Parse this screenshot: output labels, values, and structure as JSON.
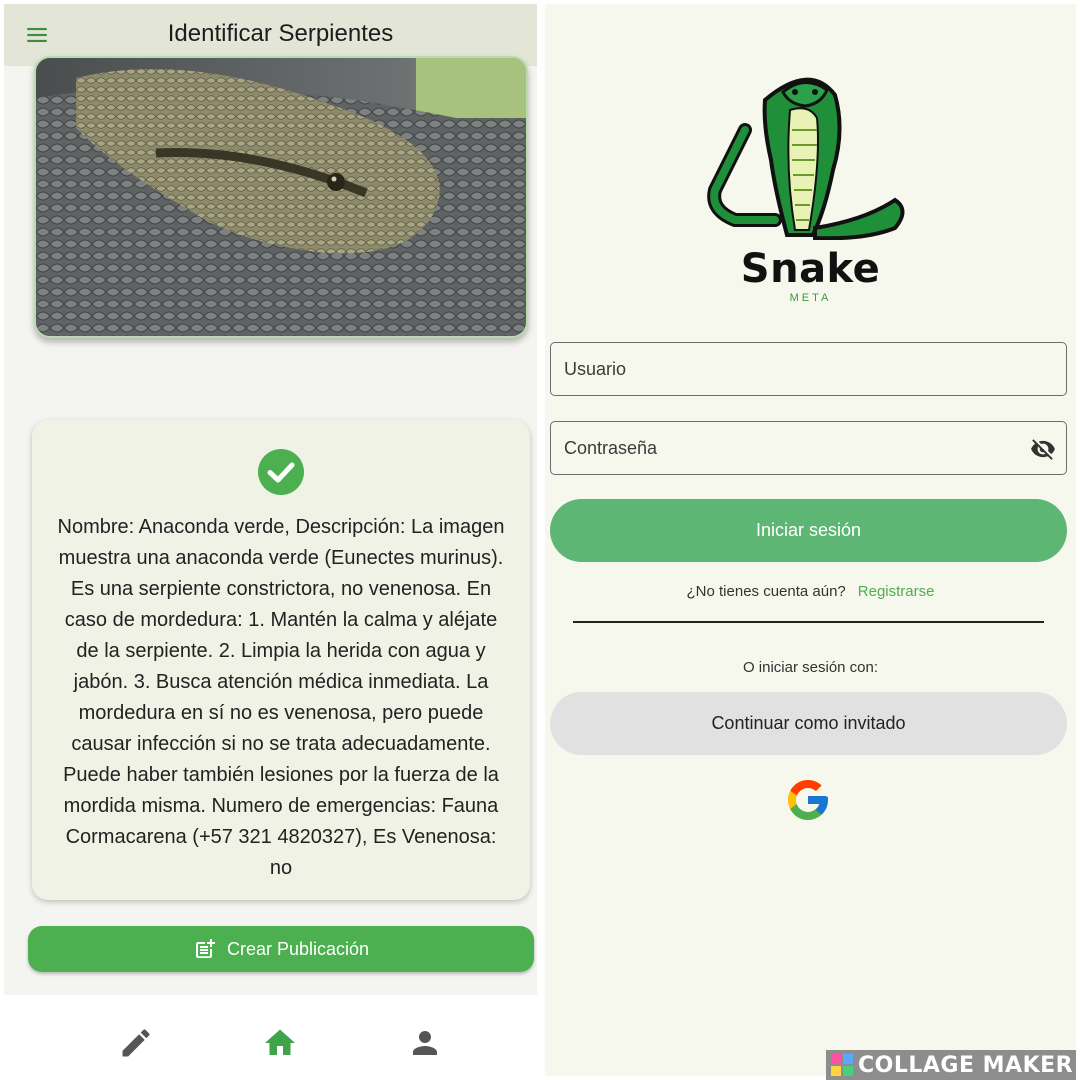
{
  "left_app": {
    "title": "Identificar Serpientes",
    "menu_icon": "hamburger-menu-icon",
    "result": {
      "status_icon": "check-circle-icon",
      "text": "Nombre: Anaconda verde, Descripción: La imagen muestra una anaconda verde (Eunectes murinus). Es una serpiente constrictora, no venenosa. En caso de mordedura: 1. Mantén la calma y aléjate de la serpiente. 2. Limpia la herida con agua y jabón. 3. Busca atención médica inmediata. La mordedura en sí no es venenosa, pero puede causar infección si no se trata adecuadamente.  Puede haber también lesiones por la fuerza de la mordida misma. Numero de emergencias: Fauna Cormacarena (+57 321 4820327), Es Venenosa: no"
    },
    "create_button": {
      "label": "Crear Publicación",
      "icon": "post-add-icon"
    },
    "bottom_nav": [
      {
        "icon": "edit-icon",
        "active": false
      },
      {
        "icon": "home-icon",
        "active": true
      },
      {
        "icon": "person-icon",
        "active": false
      }
    ]
  },
  "right_app": {
    "logo": {
      "word": "Snake",
      "sub": "META"
    },
    "username": {
      "placeholder": "Usuario",
      "value": ""
    },
    "password": {
      "placeholder": "Contraseña",
      "value": "",
      "toggle_icon": "visibility-off-icon"
    },
    "login_button": "Iniciar sesión",
    "register_prompt": "¿No tienes cuenta aún?",
    "register_link": "Registrarse",
    "alt_login": "O iniciar sesión con:",
    "guest_button": "Continuar como invitado",
    "google_icon": "google-icon"
  },
  "watermark": {
    "text": "COLLAGE MAKER"
  },
  "colors": {
    "primary_green": "#4caf50",
    "login_green": "#5db673",
    "appbar": "#e3e6d6",
    "card_bg": "#f1f2e6",
    "guest_gray": "#e1e1e1",
    "right_bg": "#f6f8ee"
  }
}
